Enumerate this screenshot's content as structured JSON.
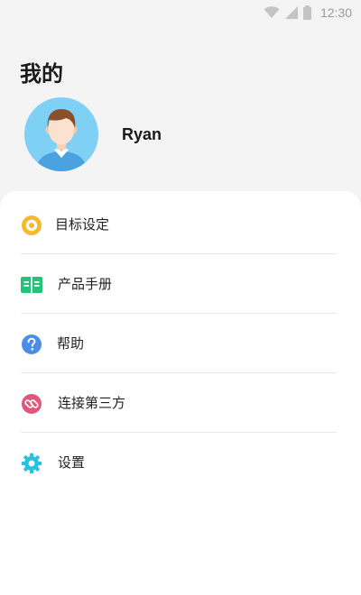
{
  "status_bar": {
    "time": "12:30",
    "icons": [
      "wifi-icon",
      "cellular-signal-icon",
      "battery-icon"
    ],
    "icon_color": "#c4c4c4"
  },
  "header": {
    "title": "我的"
  },
  "profile": {
    "username": "Ryan",
    "avatar_bg": "#7fd0f5"
  },
  "menu": {
    "items": [
      {
        "label": "目标设定",
        "icon": "target-icon",
        "color": "#f5b92e"
      },
      {
        "label": "产品手册",
        "icon": "manual-book-icon",
        "color": "#22c47a"
      },
      {
        "label": "帮助",
        "icon": "help-icon",
        "color": "#4a8ee8"
      },
      {
        "label": "连接第三方",
        "icon": "link-icon",
        "color": "#e0577c"
      },
      {
        "label": "设置",
        "icon": "gear-icon",
        "color": "#29c1e0"
      }
    ]
  }
}
